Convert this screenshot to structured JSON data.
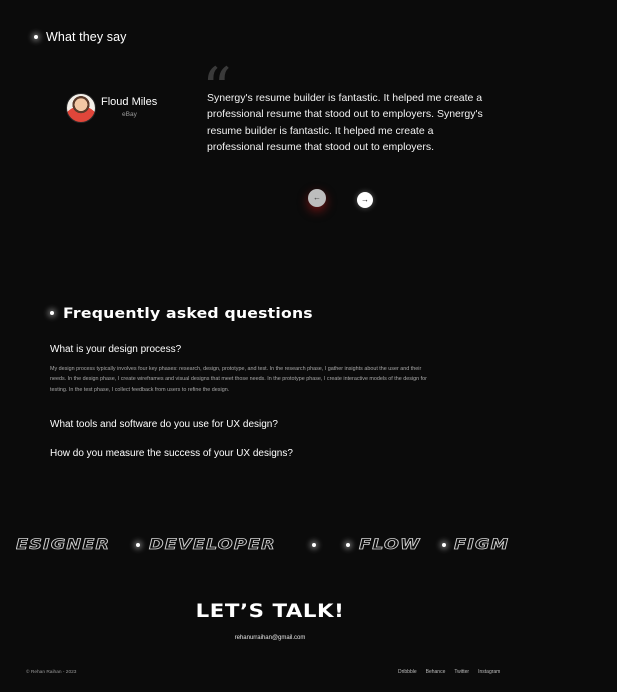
{
  "testimonials": {
    "heading": "What they say",
    "author_name": "Floud Miles",
    "author_company": "eBay",
    "quote_mark": "“",
    "quote": "Synergy's resume builder is fantastic. It helped me create a professional resume that stood out to employers. Synergy's resume builder is fantastic. It helped me create a professional resume that stood out to employers.",
    "prev_icon": "arrow-left-icon",
    "prev_symbol": "←",
    "next_icon": "arrow-right-icon",
    "next_symbol": "→"
  },
  "faq": {
    "title": "Frequently asked questions",
    "items": [
      {
        "question": "What is your design process?",
        "answer": "My design process typically involves four key phases: research, design, prototype, and test. In the research phase, I gather insights about the user and their needs. In the design phase, I create wireframes and visual designs that meet those needs. In the prototype phase, I create interactive models of the design for testing. In the test phase, I collect feedback from users to refine the design."
      },
      {
        "question": "What tools and software do you use for UX design?"
      },
      {
        "question": "How do you measure the success of your UX designs?"
      }
    ]
  },
  "marquee": {
    "group1_a": "ESIGNER",
    "group1_b": "DEVELOPER",
    "group2_a": "FLOW",
    "group2_b": "FIGM"
  },
  "cta": {
    "title": "LET’S TALK!",
    "email": "rehanurraihan@gmail.com"
  },
  "footer": {
    "copyright": "© Rehan Raihan - 2023",
    "links": [
      "Dribbble",
      "Behance",
      "Twitter",
      "Instagram"
    ]
  },
  "colors": {
    "background": "#0b0b0b",
    "text": "#ffffff",
    "muted": "#9b9b9b",
    "prev_glow": "#c81e1e"
  }
}
